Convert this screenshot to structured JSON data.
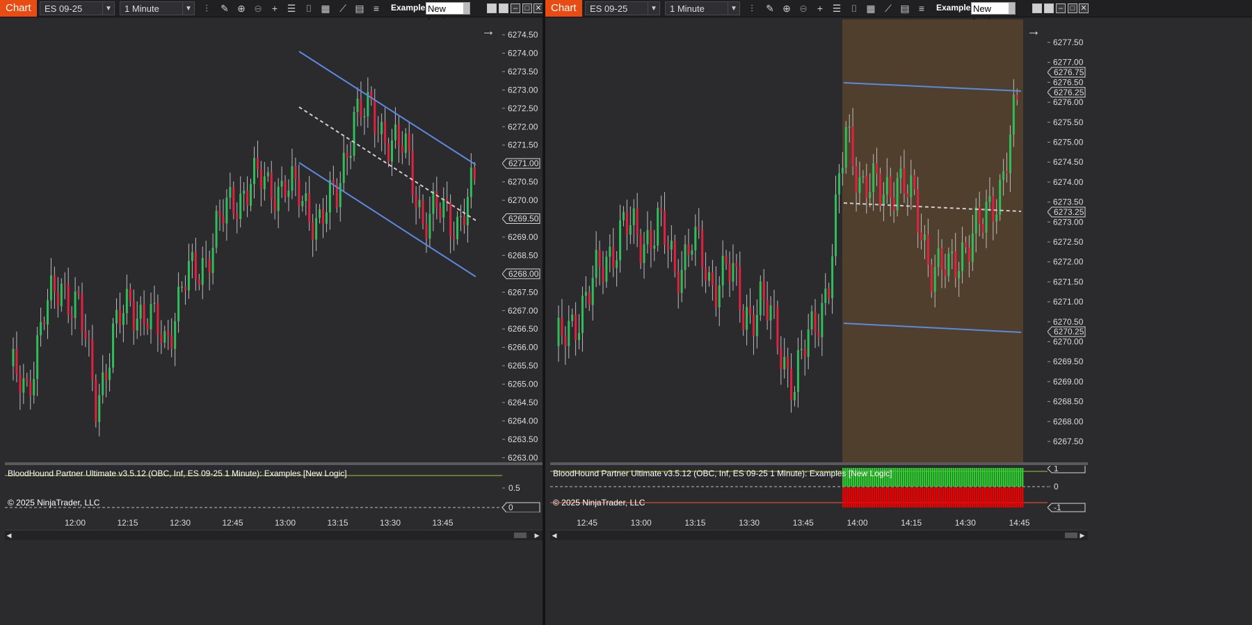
{
  "toolbar": {
    "chart_tab": "Chart",
    "instrument": "ES 09-25",
    "interval": "1 Minute",
    "strategy_label": "Examples",
    "strategy_value": "New Logic"
  },
  "left": {
    "price_axis": [
      "6274.50",
      "6274.00",
      "6273.50",
      "6273.00",
      "6272.50",
      "6272.00",
      "6271.50",
      "6271.00",
      "6270.50",
      "6270.00",
      "6269.50",
      "6269.00",
      "6268.50",
      "6268.00",
      "6267.50",
      "6267.00",
      "6266.50",
      "6266.00",
      "6265.50",
      "6265.00",
      "6264.50",
      "6264.00",
      "6263.50",
      "6263.00"
    ],
    "price_flags": [
      "6271.00",
      "6269.50",
      "6268.00"
    ],
    "time_axis": [
      "12:00",
      "12:15",
      "12:30",
      "12:45",
      "13:00",
      "13:15",
      "13:30",
      "13:45"
    ],
    "indicator_title": "BloodHound Partner Ultimate v3.5.12 (OBC, Inf, ES 09-25 1 Minute): Examples  [New Logic]",
    "copyright": "© 2025 NinjaTrader, LLC",
    "ind_axis": [
      "0.5"
    ],
    "ind_flag": "0"
  },
  "right": {
    "price_axis": [
      "6277.50",
      "6277.00",
      "6276.50",
      "6276.00",
      "6275.50",
      "6275.00",
      "6274.50",
      "6274.00",
      "6273.50",
      "6273.00",
      "6272.50",
      "6272.00",
      "6271.50",
      "6271.00",
      "6270.50",
      "6270.00",
      "6269.50",
      "6269.00",
      "6268.50",
      "6268.00",
      "6267.50"
    ],
    "price_flags": [
      "6276.75",
      "6276.25",
      "6273.25",
      "6270.25"
    ],
    "time_axis": [
      "12:45",
      "13:00",
      "13:15",
      "13:30",
      "13:45",
      "14:00",
      "14:15",
      "14:30",
      "14:45"
    ],
    "indicator_title": "BloodHound Partner Ultimate v3.5.12 (OBC, Inf, ES 09-25 1 Minute): Examples  [New Logic]",
    "copyright": "© 2025 NinjaTrader, LLC",
    "ind_axis": [
      "0"
    ],
    "ind_flags": [
      "1",
      "-1"
    ]
  },
  "colors": {
    "up": "#2fbf5a",
    "down": "#e0213f",
    "channel": "#5b8be0",
    "highlight": "#4f3f2c",
    "bull_bar": "#2ecc2e",
    "bear_bar": "#ee0000"
  }
}
